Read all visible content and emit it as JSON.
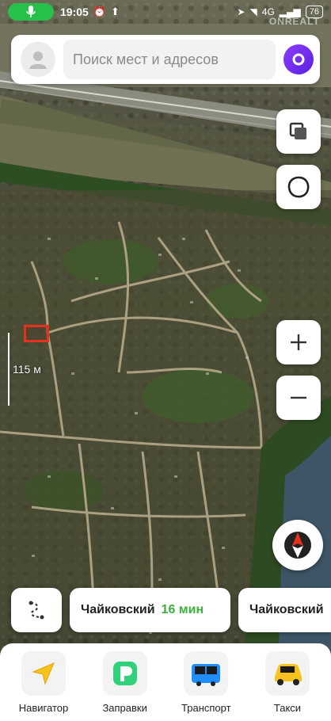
{
  "status_bar": {
    "time": "19:05",
    "network": "4G",
    "battery": "76"
  },
  "watermark": "ONREALT",
  "search": {
    "placeholder": "Поиск мест и адресов"
  },
  "map": {
    "scale_label": "115 м"
  },
  "routes": [
    {
      "destination": "Чайковский",
      "time": "16 мин"
    },
    {
      "destination": "Чайковский"
    }
  ],
  "bottom_nav": [
    {
      "label": "Навигатор",
      "icon": "navigator-arrow-icon"
    },
    {
      "label": "Заправки",
      "icon": "fuel-icon"
    },
    {
      "label": "Транспорт",
      "icon": "bus-icon"
    },
    {
      "label": "Такси",
      "icon": "taxi-icon"
    }
  ],
  "colors": {
    "accent_green": "#3cae3c",
    "alice_purple": "#7a2ff5",
    "marker_red": "#e8301c",
    "mic_green": "#27c04a"
  }
}
